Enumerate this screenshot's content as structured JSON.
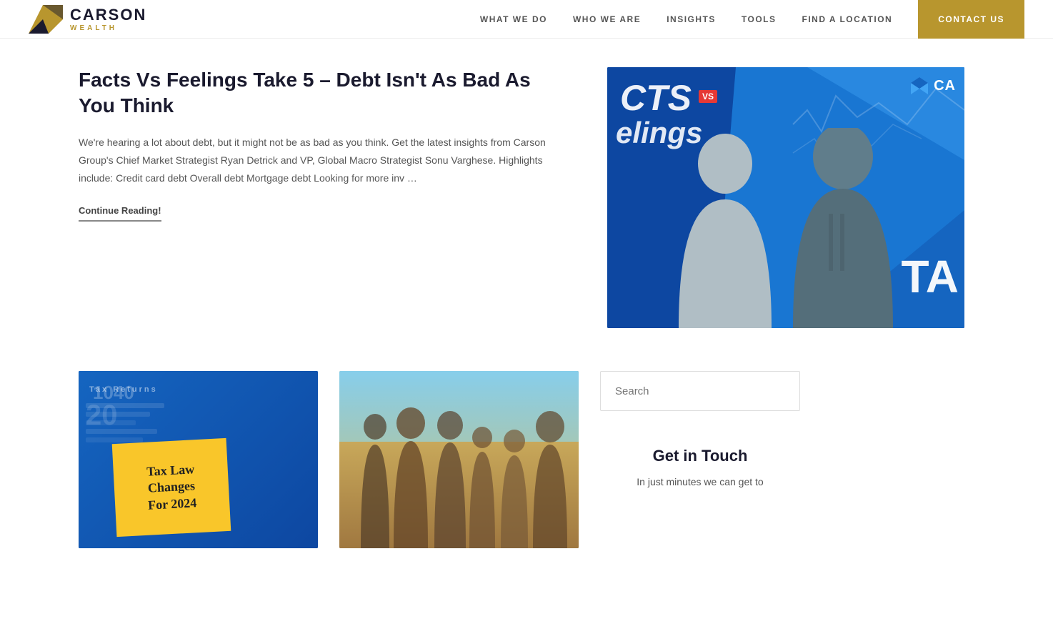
{
  "header": {
    "logo_name": "CARSON",
    "logo_sub": "WEALTH",
    "nav_items": [
      {
        "label": "WHAT WE DO",
        "id": "what-we-do"
      },
      {
        "label": "WHO WE ARE",
        "id": "who-we-are"
      },
      {
        "label": "INSIGHTS",
        "id": "insights"
      },
      {
        "label": "TOOLS",
        "id": "tools"
      },
      {
        "label": "FIND A LOCATION",
        "id": "find-location"
      }
    ],
    "contact_label": "CONTACT US"
  },
  "article": {
    "title": "Facts Vs Feelings Take 5 – Debt Isn't As Bad As You Think",
    "body": "We're hearing a lot about debt, but it might not be as bad as you think. Get the latest insights from Carson Group's Chief Market Strategist Ryan Detrick and VP, Global Macro Strategist Sonu Varghese. Highlights include: Credit card debt Overall debt Mortgage debt Looking for more inv …",
    "continue_label": "Continue Reading!",
    "image_text_cts": "CTS",
    "image_text_vs": "VS",
    "image_text_feelings": "elings",
    "image_ca_text": "CA",
    "image_ta_text": "TA"
  },
  "bottom": {
    "tax_card": {
      "label": "Tax Returns",
      "sticky_text": "Tax Law\nChanges\nFor 2024"
    },
    "family_card": {}
  },
  "sidebar": {
    "search_placeholder": "Search",
    "get_in_touch_title": "Get in Touch",
    "get_in_touch_text": "In just minutes we can get to"
  },
  "colors": {
    "gold": "#b8962e",
    "navy": "#1a1a2e",
    "blue": "#1565c0"
  }
}
